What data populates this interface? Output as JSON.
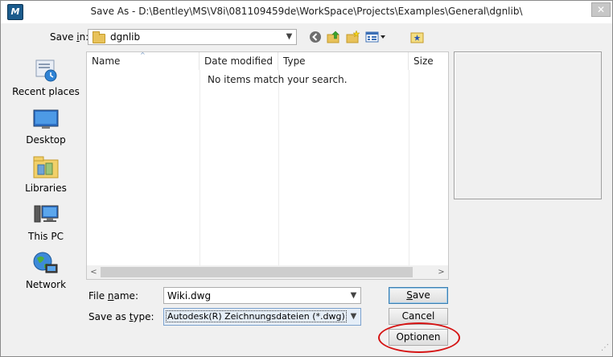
{
  "window": {
    "title": "Save As - D:\\Bentley\\MS\\V8i\\081109459de\\WorkSpace\\Projects\\Examples\\General\\dgnlib\\",
    "app_icon_letter": "M",
    "close_glyph": "✕"
  },
  "save_in": {
    "label_prefix": "Save ",
    "label_accel": "i",
    "label_suffix": "n:",
    "value": "dgnlib"
  },
  "toolbar": {
    "back_icon": "back-arrow-icon",
    "up_icon": "up-folder-icon",
    "new_folder_icon": "new-folder-icon",
    "view_icon": "view-menu-icon"
  },
  "places": [
    {
      "label": "Recent places",
      "icon": "recent-places-icon"
    },
    {
      "label": "Desktop",
      "icon": "desktop-icon"
    },
    {
      "label": "Libraries",
      "icon": "libraries-icon"
    },
    {
      "label": "This PC",
      "icon": "this-pc-icon"
    },
    {
      "label": "Network",
      "icon": "network-icon"
    }
  ],
  "list": {
    "columns": [
      "Name",
      "Date modified",
      "Type",
      "Size"
    ],
    "empty_message": "No items match your search."
  },
  "file_name": {
    "label_prefix": "File ",
    "label_accel": "n",
    "label_suffix": "ame:",
    "value": "Wiki.dwg"
  },
  "save_type": {
    "label_prefix": "Save as ",
    "label_accel": "t",
    "label_suffix": "ype:",
    "value": "Autodesk(R) Zeichnungsdateien (*.dwg)"
  },
  "buttons": {
    "save_accel": "S",
    "save_rest": "ave",
    "cancel": "Cancel",
    "options": "Optionen"
  },
  "colors": {
    "highlight_ellipse": "#d51414"
  }
}
